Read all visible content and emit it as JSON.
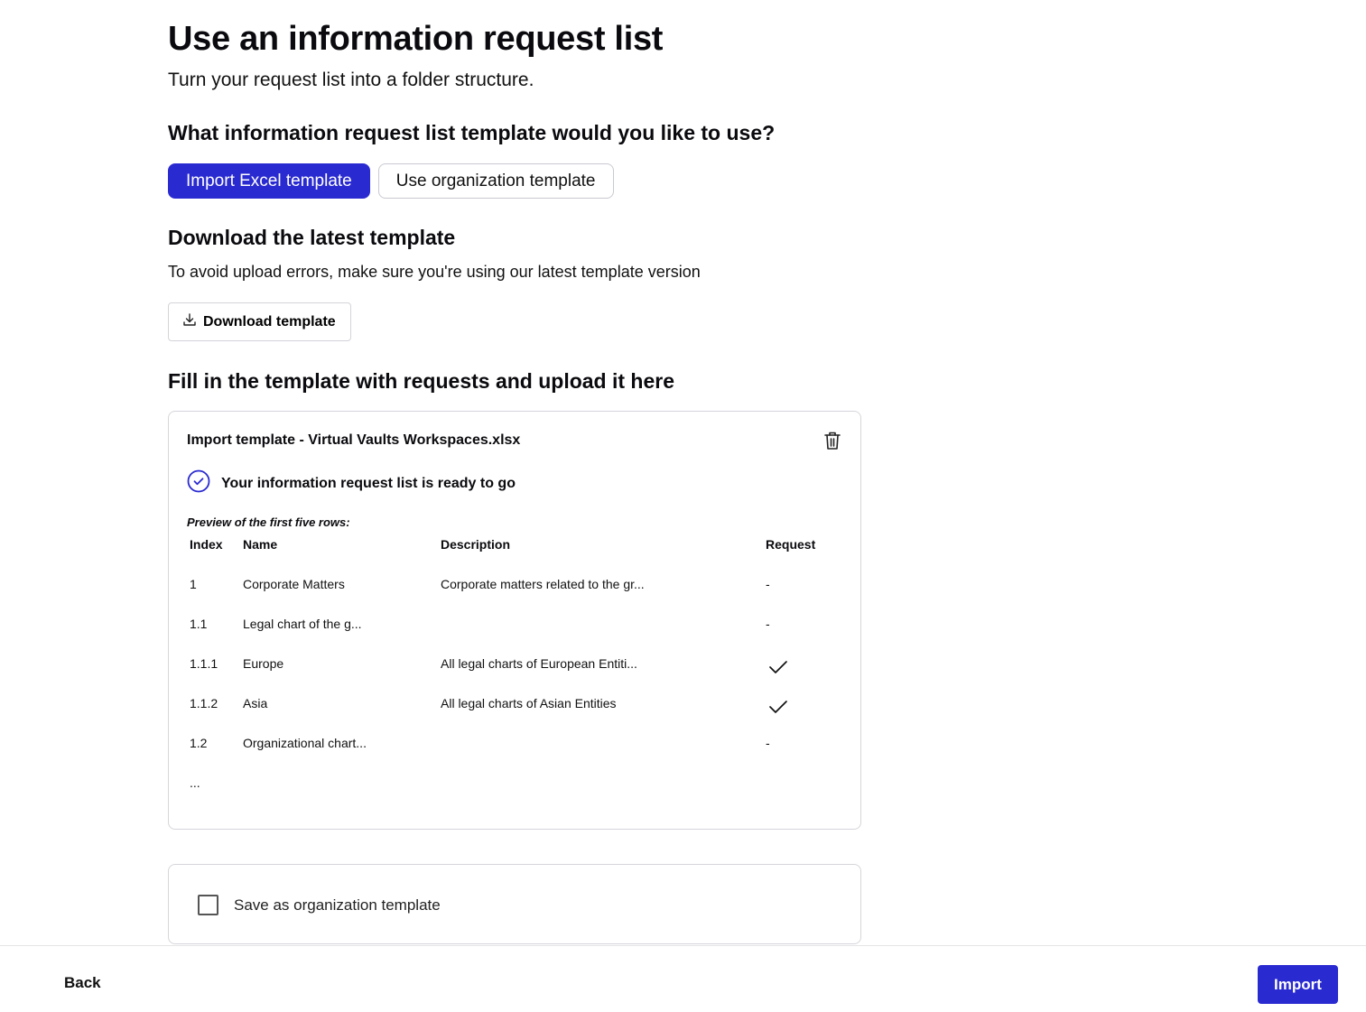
{
  "header": {
    "title": "Use an information request list",
    "subtitle": "Turn your request list into a folder structure."
  },
  "template_choice": {
    "question": "What information request list template would you like to use?",
    "options": [
      {
        "label": "Import Excel template",
        "selected": true
      },
      {
        "label": "Use organization template",
        "selected": false
      }
    ]
  },
  "download_section": {
    "heading": "Download the latest template",
    "description": "To avoid upload errors, make sure you're using our latest template version",
    "button_label": "Download template",
    "button_icon": "download-icon"
  },
  "upload_section": {
    "heading": "Fill in the template with requests and upload it here",
    "file_name": "Import template - Virtual Vaults Workspaces.xlsx",
    "delete_icon": "trash-icon",
    "status_icon": "check-circle-icon",
    "status_text": "Your information request list is ready to go",
    "preview_label": "Preview of the first five rows:",
    "columns": [
      "Index",
      "Name",
      "Description",
      "Request"
    ],
    "rows": [
      {
        "index": "1",
        "name": "Corporate Matters",
        "description": "Corporate matters related to the gr...",
        "request": "-",
        "requested": false
      },
      {
        "index": "1.1",
        "name": "Legal chart of the g...",
        "description": "",
        "request": "-",
        "requested": false
      },
      {
        "index": "1.1.1",
        "name": "Europe",
        "description": "All legal charts of European Entiti...",
        "request": "",
        "requested": true
      },
      {
        "index": "1.1.2",
        "name": "Asia",
        "description": "All legal charts of Asian Entities",
        "request": "",
        "requested": true
      },
      {
        "index": "1.2",
        "name": "Organizational chart...",
        "description": "",
        "request": "-",
        "requested": false
      }
    ],
    "ellipsis": "..."
  },
  "save_option": {
    "label": "Save as organization template",
    "checked": false
  },
  "footer": {
    "back_label": "Back",
    "import_label": "Import"
  },
  "colors": {
    "accent": "#2a2ad1",
    "border": "#d6d6dc",
    "text": "#0b0b0f"
  }
}
